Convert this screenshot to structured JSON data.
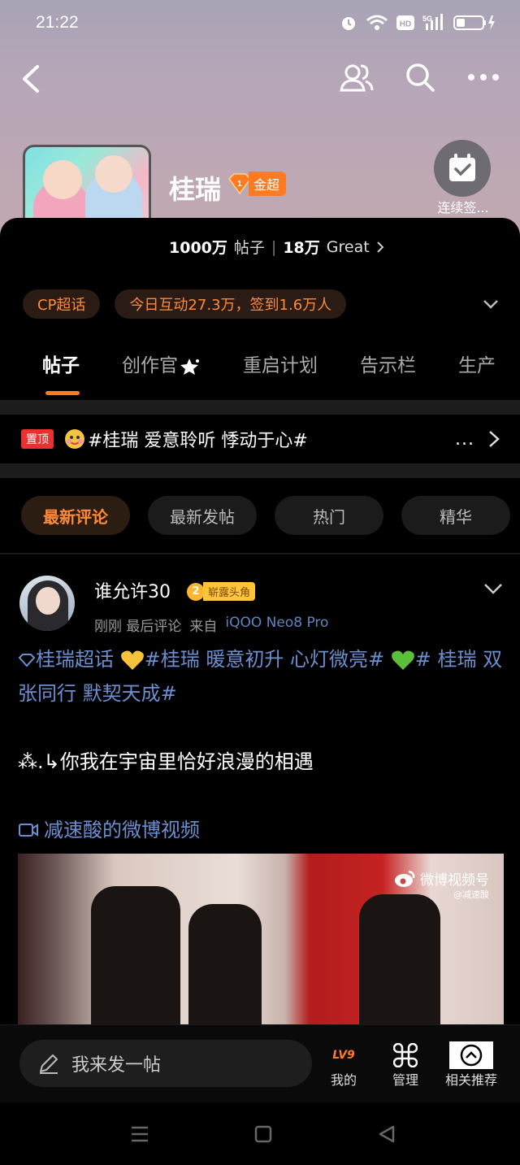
{
  "status_bar": {
    "time": "21:22"
  },
  "header": {
    "title": "桂瑞",
    "badge": "金超",
    "checkin_label": "连续签...",
    "stats": {
      "posts_count": "1000万",
      "posts_label": "帖子",
      "great_count": "18万",
      "great_label": "Great"
    }
  },
  "tags": [
    "CP超话",
    "今日互动27.3万，签到1.6万人"
  ],
  "tabs": [
    "帖子",
    "创作官",
    "重启计划",
    "告示栏",
    "生产"
  ],
  "pinned": {
    "label": "置顶",
    "text": "#桂瑞 爱意聆听 悸动于心#",
    "more": "..."
  },
  "filters": [
    "最新评论",
    "最新发帖",
    "热门",
    "精华"
  ],
  "post": {
    "username": "谁允许30",
    "badge_level": "2",
    "badge_text": "崭露头角",
    "meta_time": "刚刚 最后评论",
    "meta_from": "来自",
    "meta_device": "iQOO Neo8 Pro",
    "hashtag1": "桂瑞超话",
    "hashtag2": "#桂瑞 暖意初升 心灯微亮#",
    "hashtag3": "#",
    "hashtag4": "桂瑞 双张同行 默契天成#",
    "line": "⁂.↳你我在宇宙里恰好浪漫的相遇",
    "video_link": "减速酸的微博视频",
    "watermark": "微博视频号",
    "watermark_sub": "@减速酸"
  },
  "bottom_bar": {
    "compose_placeholder": "我来发一帖",
    "mine_label": "我的",
    "level": "LV9",
    "manage_label": "管理",
    "related_label": "相关推荐"
  },
  "colors": {
    "accent": "#ff7a22",
    "link": "#6b8fd1"
  }
}
